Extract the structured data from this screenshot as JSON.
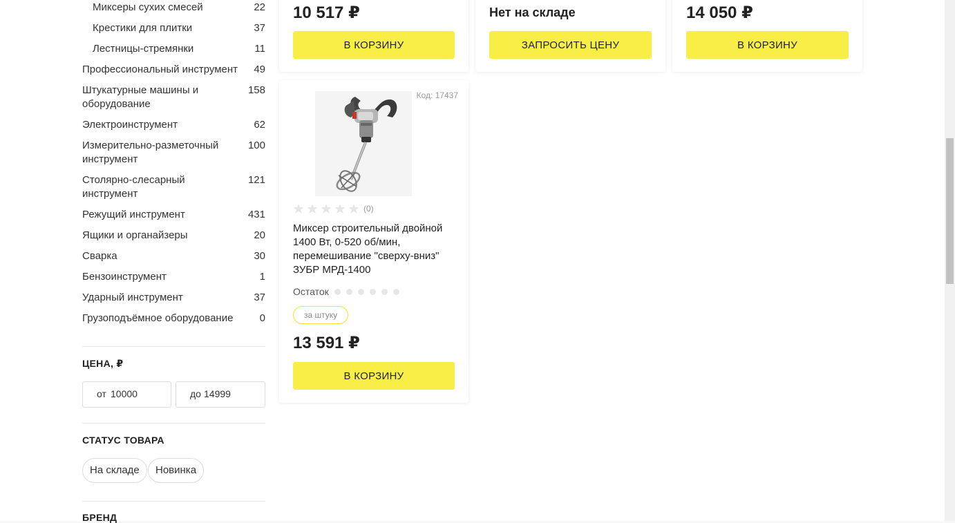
{
  "categories": [
    {
      "name": "Миксеры сухих смесей",
      "count": "22",
      "sub": true
    },
    {
      "name": "Крестики для плитки",
      "count": "37",
      "sub": true
    },
    {
      "name": "Лестницы-стремянки",
      "count": "11",
      "sub": true
    },
    {
      "name": "Профессиональный инструмент",
      "count": "49"
    },
    {
      "name": "Штукатурные машины и оборудование",
      "count": "158"
    },
    {
      "name": "Электроинструмент",
      "count": "62"
    },
    {
      "name": "Измерительно-разметочный инструмент",
      "count": "100"
    },
    {
      "name": "Столярно-слесарный инструмент",
      "count": "121"
    },
    {
      "name": "Режущий инструмент",
      "count": "431"
    },
    {
      "name": "Ящики и органайзеры",
      "count": "20"
    },
    {
      "name": "Сварка",
      "count": "30"
    },
    {
      "name": "Бензоинструмент",
      "count": "1"
    },
    {
      "name": "Ударный инструмент",
      "count": "37"
    },
    {
      "name": "Грузоподъёмное оборудование",
      "count": "0"
    }
  ],
  "filters": {
    "price_title": "ЦЕНА, ₽",
    "price_from_label": "от",
    "price_from_value": "10000",
    "price_to_label": "до",
    "price_to_value": "14999",
    "status_title": "СТАТУС ТОВАРА",
    "status_options": [
      "На складе",
      "Новинка"
    ],
    "brand_title": "БРЕНД"
  },
  "top_cards": [
    {
      "price": "10 517 ₽",
      "button": "В КОРЗИНУ"
    },
    {
      "availability": "Нет на складе",
      "button": "ЗАПРОСИТЬ ЦЕНУ"
    },
    {
      "price": "14 050 ₽",
      "button": "В КОРЗИНУ"
    }
  ],
  "product": {
    "code": "Код: 17437",
    "rating_count": "(0)",
    "stars": 5,
    "name": "Миксер строительный двойной 1400 Вт, 0-520 об/мин, перемешивание \"сверху-вниз\" ЗУБР МРД-1400",
    "stock_label": "Остаток",
    "stock_dots": 6,
    "unit": "за штуку",
    "price": "13 591 ₽",
    "button": "В КОРЗИНУ"
  },
  "colors": {
    "accent": "#f9ee45",
    "star": "#e6e6e6"
  },
  "icons": {
    "star": "star-icon",
    "product_image": "mixer-drill-image"
  }
}
